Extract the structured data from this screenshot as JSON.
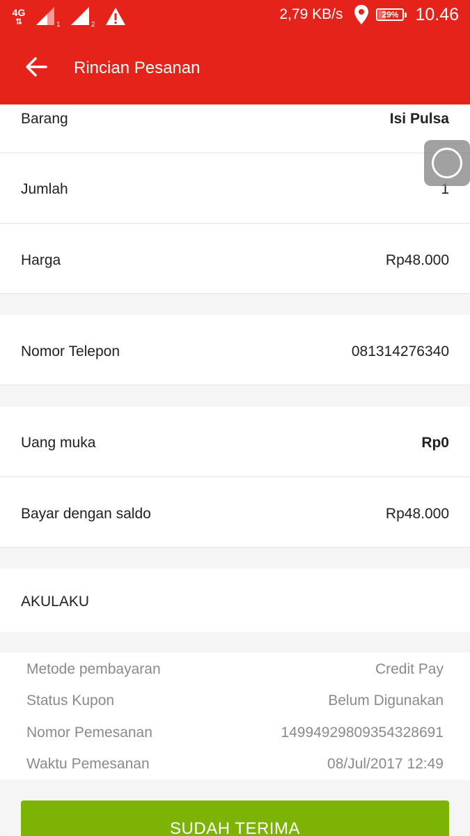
{
  "status_bar": {
    "network_label": "4G",
    "sim1_index": "1",
    "sim2_index": "2",
    "speed": "2,79 KB/s",
    "battery": {
      "percent_label": "29%",
      "level": 0.29
    },
    "time": "10.46"
  },
  "header": {
    "title": "Rincian Pesanan"
  },
  "order": {
    "barang": {
      "label": "Barang",
      "value": "Isi Pulsa"
    },
    "jumlah": {
      "label": "Jumlah",
      "value": "1"
    },
    "harga": {
      "label": "Harga",
      "value": "Rp48.000"
    }
  },
  "phone": {
    "label": "Nomor Telepon",
    "value": "081314276340"
  },
  "payment": {
    "uang_muka": {
      "label": "Uang muka",
      "value": "Rp0"
    },
    "saldo": {
      "label": "Bayar dengan saldo",
      "value": "Rp48.000"
    }
  },
  "seller": {
    "name": "AKULAKU"
  },
  "details": [
    {
      "label": "Metode pembayaran",
      "value": "Credit Pay"
    },
    {
      "label": "Status Kupon",
      "value": "Belum Digunakan"
    },
    {
      "label": "Nomor Pemesanan",
      "value": "14994929809354328691"
    },
    {
      "label": "Waktu Pemesanan",
      "value": "08/Jul/2017 12:49"
    }
  ],
  "actions": {
    "confirm_label": "SUDAH TERIMA"
  },
  "colors": {
    "brand_red": "#e5231a",
    "confirm_green": "#7cb305"
  },
  "icons": [
    "back-arrow-icon",
    "signal-icon",
    "warning-icon",
    "location-pin-icon",
    "battery-icon",
    "assistive-touch-icon"
  ]
}
